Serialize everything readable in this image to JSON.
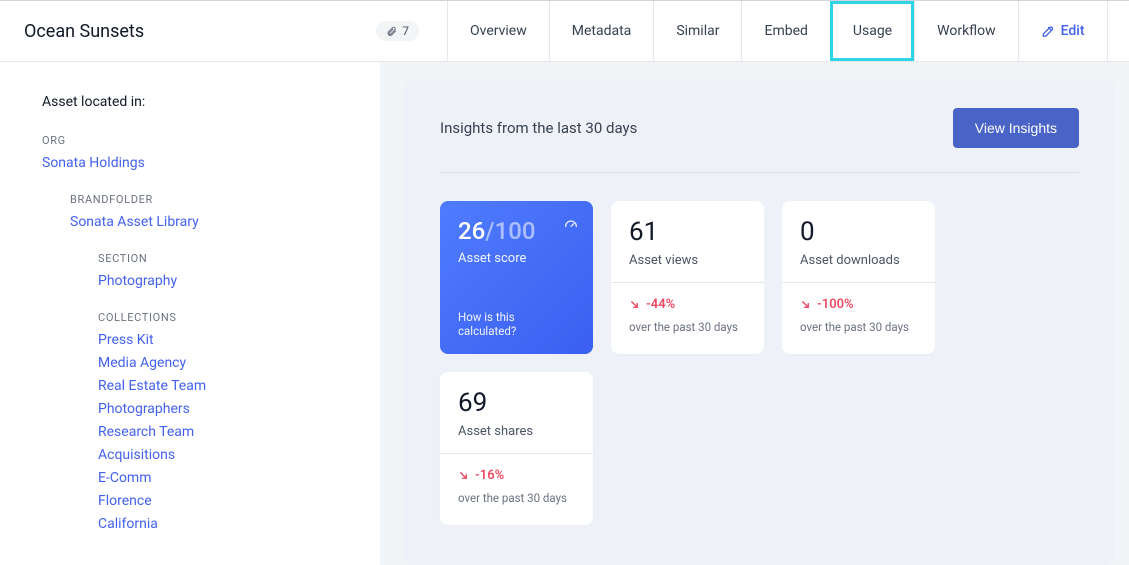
{
  "header": {
    "title": "Ocean Sunsets",
    "attachment_count": "7",
    "tabs": [
      "Overview",
      "Metadata",
      "Similar",
      "Embed",
      "Usage",
      "Workflow"
    ],
    "active_tab": "Usage",
    "edit_label": "Edit"
  },
  "sidebar": {
    "title": "Asset located in:",
    "org_label": "ORG",
    "org_link": "Sonata Holdings",
    "brandfolder_label": "BRANDFOLDER",
    "brandfolder_link": "Sonata Asset Library",
    "section_label": "SECTION",
    "section_link": "Photography",
    "collections_label": "COLLECTIONS",
    "collections": [
      "Press Kit",
      "Media Agency",
      "Real Estate Team",
      "Photographers",
      "Research Team",
      "Acquisitions",
      "E-Comm",
      "Florence",
      "California"
    ]
  },
  "panel": {
    "title": "Insights from the last 30 days",
    "view_button": "View Insights",
    "score": {
      "value": "26",
      "denom": "/100",
      "label": "Asset score",
      "help": "How is this calculated?"
    },
    "cards": [
      {
        "value": "61",
        "label": "Asset views",
        "delta": "-44%",
        "sub": "over the past 30 days"
      },
      {
        "value": "0",
        "label": "Asset downloads",
        "delta": "-100%",
        "sub": "over the past 30 days"
      },
      {
        "value": "69",
        "label": "Asset shares",
        "delta": "-16%",
        "sub": "over the past 30 days"
      }
    ]
  }
}
